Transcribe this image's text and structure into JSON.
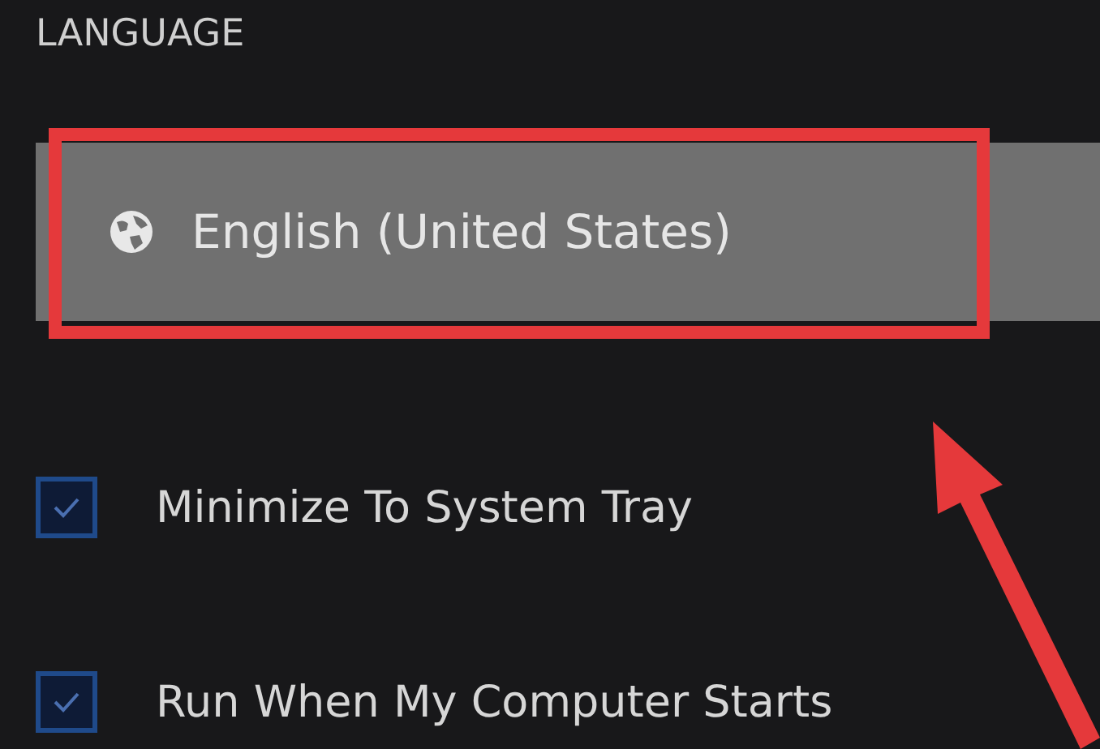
{
  "section": {
    "heading": "LANGUAGE"
  },
  "language_select": {
    "value": "English (United States)",
    "highlighted": true
  },
  "options": [
    {
      "label": "Minimize To System Tray",
      "checked": true
    },
    {
      "label": "Run When My Computer Starts",
      "checked": true
    }
  ]
}
